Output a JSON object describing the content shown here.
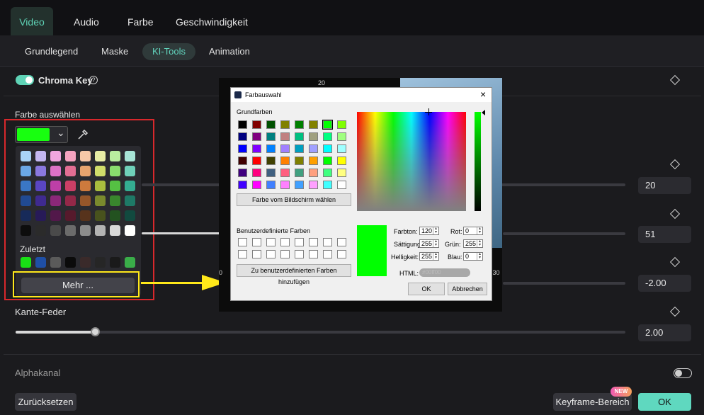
{
  "tabs": {
    "video": "Video",
    "audio": "Audio",
    "farbe": "Farbe",
    "geschwindigkeit": "Geschwindigkeit"
  },
  "subtabs": {
    "grundlegend": "Grundlegend",
    "maske": "Maske",
    "ki_tools": "KI-Tools",
    "animation": "Animation"
  },
  "chroma_key": {
    "label": "Chroma Key",
    "help_icon": "?",
    "enabled": true
  },
  "farbe_auswaehlen": {
    "label": "Farbe auswählen",
    "selected_color": "#18ff10",
    "chevron": "⌄"
  },
  "palette": {
    "rows": [
      [
        "#a9d3f6",
        "#c4b7f1",
        "#f1a6df",
        "#f5a3bf",
        "#f7c8a8",
        "#e8eda5",
        "#b9ed9f",
        "#a7e5d6"
      ],
      [
        "#6ba7e5",
        "#8a78de",
        "#dd72c6",
        "#e36e93",
        "#e8a46e",
        "#d0dd6a",
        "#89dc6e",
        "#6fd0b9"
      ],
      [
        "#3a77c5",
        "#5a46c4",
        "#be3fa7",
        "#cb3f66",
        "#cd7a3d",
        "#a9bd3e",
        "#55c043",
        "#34ad91"
      ],
      [
        "#214a92",
        "#3f2a8f",
        "#8a2878",
        "#942848",
        "#95562a",
        "#7a8a2d",
        "#39862d",
        "#1e7966"
      ],
      [
        "#172a59",
        "#271a58",
        "#52184a",
        "#561a2c",
        "#57331c",
        "#48521d",
        "#235220",
        "#124a3f"
      ],
      [
        "#0d0d0d",
        "#2b2b2b",
        "#4a4a4a",
        "#6b6b6b",
        "#8c8c8c",
        "#b3b3b3",
        "#d8d8d8",
        "#ffffff"
      ]
    ],
    "zuletzt_label": "Zuletzt",
    "recent": [
      "#19e015",
      "#1f4fa6",
      "#5a5a5a",
      "#0b0b0b",
      "#3a2a2a",
      "#262626",
      "#1a1a1a",
      "#3aad49"
    ],
    "mehr_label": "Mehr ..."
  },
  "right_values": {
    "v1": "20",
    "v2": "51",
    "v3": "-2.00",
    "v4": "2.00"
  },
  "kante_feder": {
    "label": "Kante-Feder",
    "value": 0.13
  },
  "alphakanal": {
    "label": "Alphakanal",
    "enabled": false
  },
  "bottom": {
    "reset": "Zurücksetzen",
    "keyframe": "Keyframe-Bereich",
    "new_badge": "NEW",
    "ok": "OK"
  },
  "background_preview": {
    "top_number": "20",
    "tick_left": "0",
    "tick_right": ":30"
  },
  "dialog": {
    "title": "Farbauswahl",
    "close": "×",
    "grundfarben_label": "Grundfarben",
    "grundfarben": [
      [
        "#000000",
        "#800000",
        "#005000",
        "#808000",
        "#008000",
        "#808000",
        "#00ff00",
        "#80ff00"
      ],
      [
        "#000080",
        "#800080",
        "#008080",
        "#c08080",
        "#00c080",
        "#a0a080",
        "#00ff80",
        "#a0ff80"
      ],
      [
        "#0000ff",
        "#8000ff",
        "#0080ff",
        "#a080ff",
        "#00a0c0",
        "#a0a0ff",
        "#00ffff",
        "#a0ffff"
      ],
      [
        "#400000",
        "#ff0000",
        "#404000",
        "#ff8000",
        "#808000",
        "#ffa000",
        "#00ff00",
        "#ffff00"
      ],
      [
        "#400080",
        "#ff0080",
        "#406080",
        "#ff6080",
        "#40a080",
        "#ffa080",
        "#40ff80",
        "#ffff80"
      ],
      [
        "#4000ff",
        "#ff00ff",
        "#4080ff",
        "#ff80ff",
        "#40a0ff",
        "#ffa0ff",
        "#40ffff",
        "#ffffff"
      ]
    ],
    "pick_screen": "Farbe vom Bildschirm wählen",
    "custom_label": "Benutzerdefinierte Farben",
    "add_custom": "Zu benutzerdefinierten Farben hinzufügen",
    "preview_color": "#00ff00",
    "farbton_label": "Farbton:",
    "farbton": "120",
    "saettigung_label": "Sättigung:",
    "saettigung": "255",
    "helligkeit_label": "Helligkeit:",
    "helligkeit": "255",
    "rot_label": "Rot:",
    "rot": "0",
    "gruen_label": "Grün:",
    "gruen": "255",
    "blau_label": "Blau:",
    "blau": "0",
    "html_label": "HTML:",
    "html_value": "#00ff00",
    "ok": "OK",
    "abbrechen": "Abbrechen"
  }
}
